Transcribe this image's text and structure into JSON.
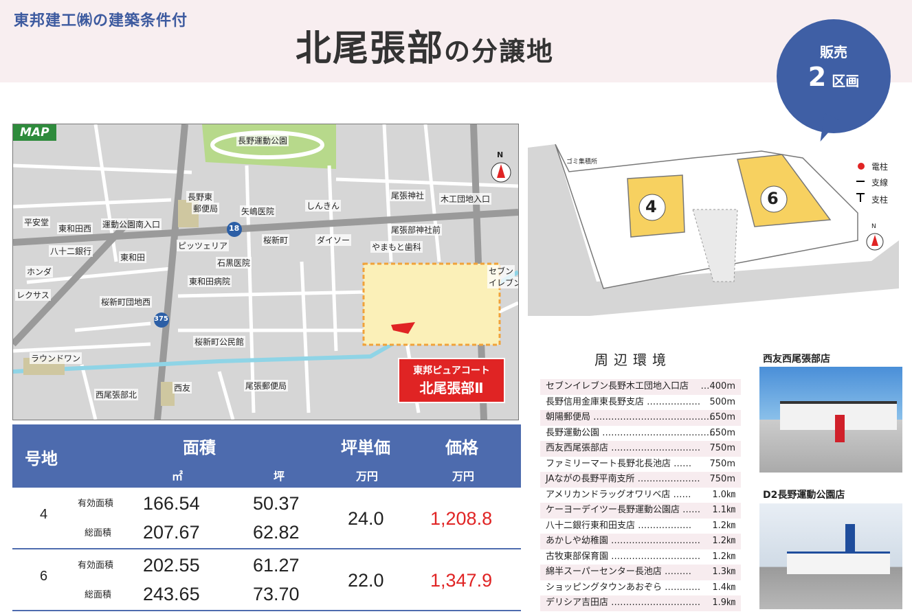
{
  "header": {
    "subtitle": "東邦建工㈱の建築条件付",
    "title_main": "北尾張部",
    "title_tail": "の分譲地"
  },
  "badge": {
    "line1": "販売",
    "count": "2",
    "unit": "区画"
  },
  "map": {
    "label": "MAP",
    "project_line1": "東邦ピュアコート",
    "project_line2": "北尾張部Ⅱ",
    "places": [
      {
        "t": "長野運動公園"
      },
      {
        "t": "長野東"
      },
      {
        "t": "郵便局"
      },
      {
        "t": "矢嶋医院"
      },
      {
        "t": "しんきん"
      },
      {
        "t": "尾張神社"
      },
      {
        "t": "木工団地入口"
      },
      {
        "t": "平安堂"
      },
      {
        "t": "東和田西"
      },
      {
        "t": "運動公園南入口"
      },
      {
        "t": "桜新町"
      },
      {
        "t": "ダイソー"
      },
      {
        "t": "尾張部神社前"
      },
      {
        "t": "やまもと歯科"
      },
      {
        "t": "八十二銀行"
      },
      {
        "t": "東和田"
      },
      {
        "t": "ピッツェリア"
      },
      {
        "t": "石黒医院"
      },
      {
        "t": "セブン"
      },
      {
        "t": "イレブン"
      },
      {
        "t": "ホンダ"
      },
      {
        "t": "東和田病院"
      },
      {
        "t": "レクサス"
      },
      {
        "t": "桜新町団地西"
      },
      {
        "t": "桜新町公民館"
      },
      {
        "t": "ラウンドワン"
      },
      {
        "t": "西友"
      },
      {
        "t": "尾張郵便局"
      },
      {
        "t": "西尾張部北"
      }
    ],
    "route18": "18",
    "route375": "375",
    "north": "N"
  },
  "plan": {
    "lot4": "4",
    "lot6": "6",
    "gomi": "ゴミ集積所",
    "legend": [
      "電柱",
      "支線",
      "支柱"
    ],
    "north": "N"
  },
  "table": {
    "h_lot": "号地",
    "h_area": "面積",
    "h_unit_price": "坪単価",
    "h_price": "価格",
    "u_m2": "㎡",
    "u_tsubo": "坪",
    "u_man1": "万円",
    "u_man2": "万円",
    "rows": [
      {
        "lot": "4",
        "eff_label": "有効面積",
        "eff_m2": "166.54",
        "eff_tsubo": "50.37",
        "tot_label": "総面積",
        "tot_m2": "207.67",
        "tot_tsubo": "62.82",
        "unit_price": "24.0",
        "price": "1,208.8"
      },
      {
        "lot": "6",
        "eff_label": "有効面積",
        "eff_m2": "202.55",
        "eff_tsubo": "61.27",
        "tot_label": "総面積",
        "tot_m2": "243.65",
        "tot_tsubo": "73.70",
        "unit_price": "22.0",
        "price": "1,347.9"
      }
    ]
  },
  "env": {
    "title": "周辺環境",
    "items": [
      {
        "name": "セブンイレブン長野木工団地入口店",
        "dist": "…400m"
      },
      {
        "name": "長野信用金庫東長野支店 ………………",
        "dist": "500m"
      },
      {
        "name": "朝陽郵便局 ……………………………………",
        "dist": "650m"
      },
      {
        "name": "長野運動公園 …………………………………",
        "dist": "650m"
      },
      {
        "name": "西友西尾張部店 …………………………",
        "dist": "750m"
      },
      {
        "name": "ファミリーマート長野北長池店 ……",
        "dist": "750m"
      },
      {
        "name": "JAながの長野平南支所 …………………",
        "dist": "750m"
      },
      {
        "name": "アメリカンドラッグオワリベ店 ……",
        "dist": "1.0㎞"
      },
      {
        "name": "ケーヨーデイツー長野運動公園店 ……",
        "dist": "1.1㎞"
      },
      {
        "name": "八十二銀行東和田支店 ………………",
        "dist": "1.2㎞"
      },
      {
        "name": "あかしや幼稚園 …………………………",
        "dist": "1.2㎞"
      },
      {
        "name": "古牧東部保育園 …………………………",
        "dist": "1.2㎞"
      },
      {
        "name": "綿半スーパーセンター長池店 ………",
        "dist": "1.3㎞"
      },
      {
        "name": "ショッピングタウンあおぞら …………",
        "dist": "1.4㎞"
      },
      {
        "name": "デリシア吉田店 …………………………",
        "dist": "1.9㎞"
      }
    ]
  },
  "photos": {
    "cap1": "西友西尾張部店",
    "cap2": "D2長野運動公園店"
  }
}
